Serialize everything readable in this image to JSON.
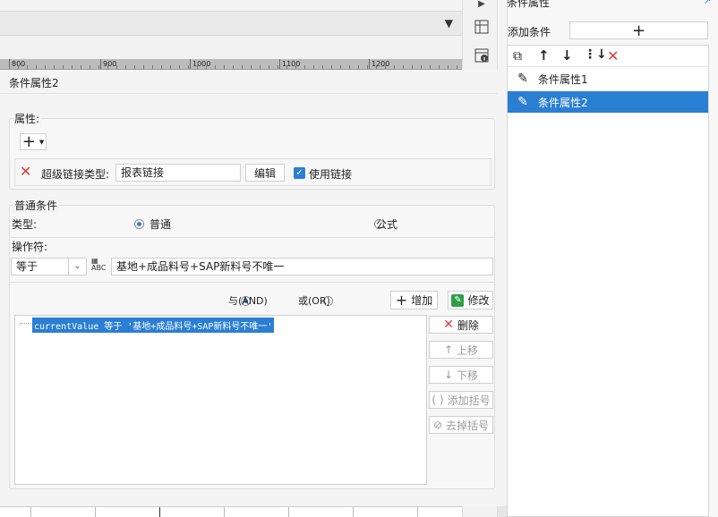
{
  "ruler": {
    "ticks": [
      "800",
      "900",
      "1000",
      "1100",
      "1200"
    ]
  },
  "panel": {
    "title": "条件属性2"
  },
  "properties": {
    "label": "属性:",
    "add_symbol": "+",
    "hyperlink_type_label": "超级链接类型:",
    "hyperlink_type_value": "报表链接",
    "edit_button": "编辑",
    "use_link_label": "使用链接",
    "use_link_checked": true
  },
  "conditions": {
    "group_label": "普通条件",
    "type_label": "类型:",
    "type_option_normal": "普通",
    "type_option_formula": "公式",
    "selected_type": "普通",
    "operator_label": "操作符:",
    "operator_value": "等于",
    "value_text": "基地+成品料号+SAP新料号不唯一",
    "and_label": "与(AND)",
    "or_label": "或(OR)",
    "logic_selected": "与(AND)",
    "add_button": "增加",
    "modify_button": "修改",
    "expression": "currentValue 等于 '基地+成品料号+SAP新料号不唯一'",
    "delete_button": "删除",
    "move_up_button": "上移",
    "move_down_button": "下移",
    "add_bracket_button": "添加括号",
    "remove_bracket_button": "去掉括号"
  },
  "right_panel": {
    "title": "条件属性",
    "add_condition_label": "添加条件",
    "add_symbol": "+",
    "items": [
      {
        "label": "条件属性1",
        "selected": false
      },
      {
        "label": "条件属性2",
        "selected": true
      }
    ]
  },
  "colors": {
    "accent": "#2b7fd3",
    "delete_red": "#e03a3a",
    "add_green": "#2e9e45"
  }
}
